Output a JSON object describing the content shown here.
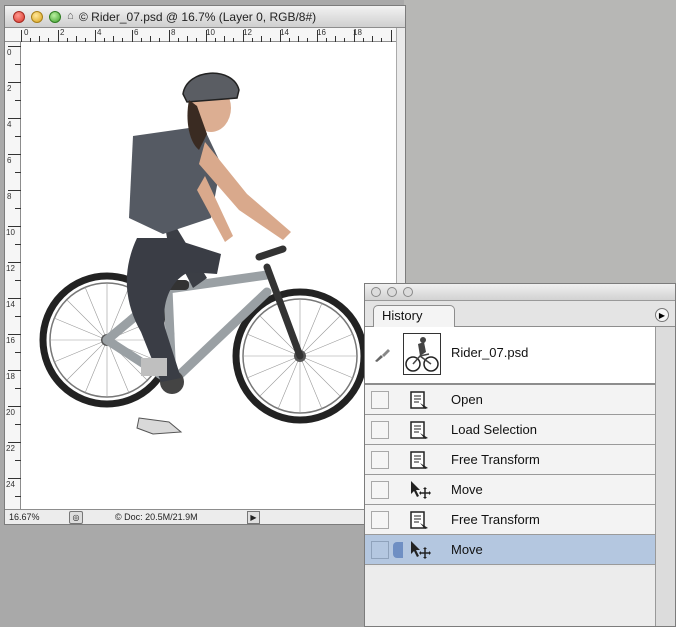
{
  "document": {
    "title": "© Rider_07.psd @ 16.7% (Layer 0, RGB/8#)",
    "ruler_h": [
      "0",
      "2",
      "4",
      "6",
      "8",
      "10",
      "12",
      "14",
      "16",
      "18"
    ],
    "ruler_v": [
      "0",
      "2",
      "4",
      "6",
      "8",
      "10",
      "12",
      "14",
      "16",
      "18",
      "20",
      "22",
      "24"
    ],
    "zoom": "16.67%",
    "doc_size": "© Doc: 20.5M/21.9M"
  },
  "history": {
    "tab_label": "History",
    "snapshot_name": "Rider_07.psd",
    "items": [
      {
        "label": "Open",
        "icon": "document-brush-icon"
      },
      {
        "label": "Load Selection",
        "icon": "document-brush-icon"
      },
      {
        "label": "Free Transform",
        "icon": "document-brush-icon"
      },
      {
        "label": "Move",
        "icon": "move-tool-icon"
      },
      {
        "label": "Free Transform",
        "icon": "document-brush-icon"
      },
      {
        "label": "Move",
        "icon": "move-tool-icon"
      }
    ],
    "selected_index": 5
  },
  "colors": {
    "selection": "#b4c7e0",
    "background": "#a9a9a9"
  }
}
